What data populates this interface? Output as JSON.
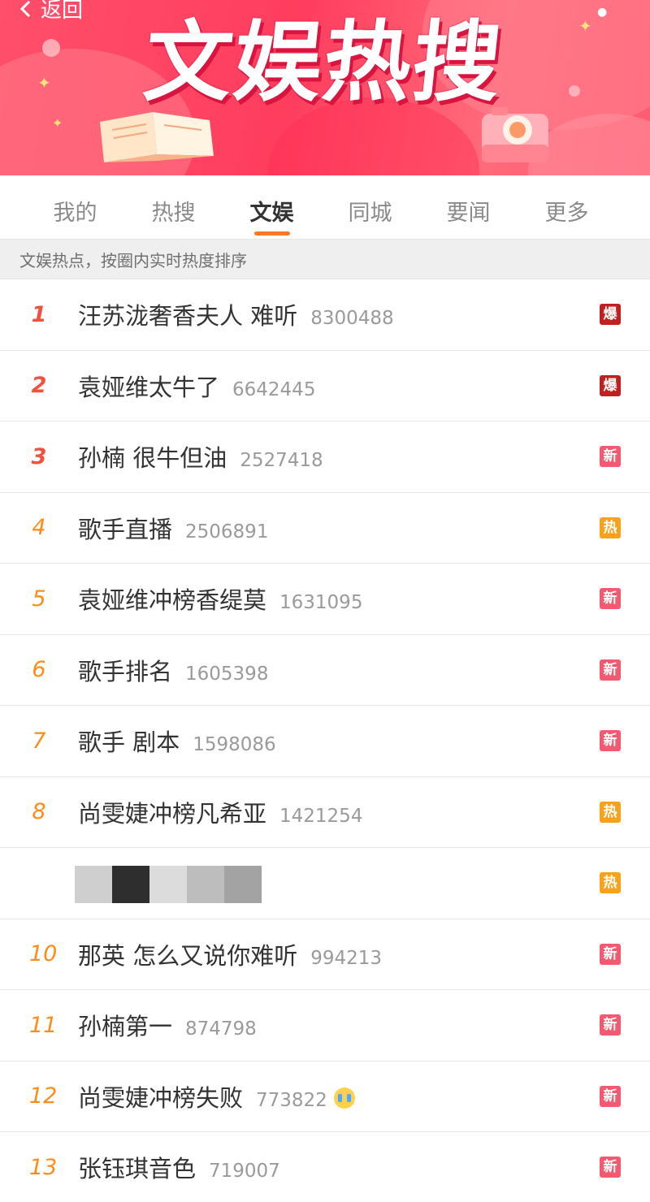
{
  "banner": {
    "back_label": "返回",
    "title": "文娱热搜"
  },
  "tabs": [
    {
      "label": "我的",
      "active": false
    },
    {
      "label": "热搜",
      "active": false
    },
    {
      "label": "文娱",
      "active": true
    },
    {
      "label": "同城",
      "active": false
    },
    {
      "label": "要闻",
      "active": false
    },
    {
      "label": "更多",
      "active": false
    }
  ],
  "subheader": "文娱热点，按圈内实时热度排序",
  "colors": {
    "accent": "#ff7a1f",
    "rank_top": "#f0523d",
    "rank_normal": "#ff8c1a",
    "badge_bao": "#c0201f",
    "badge_xin": "#f35a6f",
    "badge_re": "#f7a21a"
  },
  "items": [
    {
      "rank": "1",
      "title": "汪苏泷奢香夫人 难听",
      "count": "8300488",
      "badge": "爆"
    },
    {
      "rank": "2",
      "title": "袁娅维太牛了",
      "count": "6642445",
      "badge": "爆"
    },
    {
      "rank": "3",
      "title": "孙楠 很牛但油",
      "count": "2527418",
      "badge": "新"
    },
    {
      "rank": "4",
      "title": "歌手直播",
      "count": "2506891",
      "badge": "热"
    },
    {
      "rank": "5",
      "title": "袁娅维冲榜香缇莫",
      "count": "1631095",
      "badge": "新"
    },
    {
      "rank": "6",
      "title": "歌手排名",
      "count": "1605398",
      "badge": "新"
    },
    {
      "rank": "7",
      "title": "歌手 剧本",
      "count": "1598086",
      "badge": "新"
    },
    {
      "rank": "8",
      "title": "尚雯婕冲榜凡希亚",
      "count": "1421254",
      "badge": "热"
    },
    {
      "rank": "",
      "title": "",
      "count": "",
      "badge": "热"
    },
    {
      "rank": "10",
      "title": "那英 怎么又说你难听",
      "count": "994213",
      "badge": "新"
    },
    {
      "rank": "11",
      "title": "孙楠第一",
      "count": "874798",
      "badge": "新"
    },
    {
      "rank": "12",
      "title": "尚雯婕冲榜失败",
      "count": "773822",
      "badge": "新"
    },
    {
      "rank": "13",
      "title": "张钰琪音色",
      "count": "719007",
      "badge": "新"
    }
  ]
}
